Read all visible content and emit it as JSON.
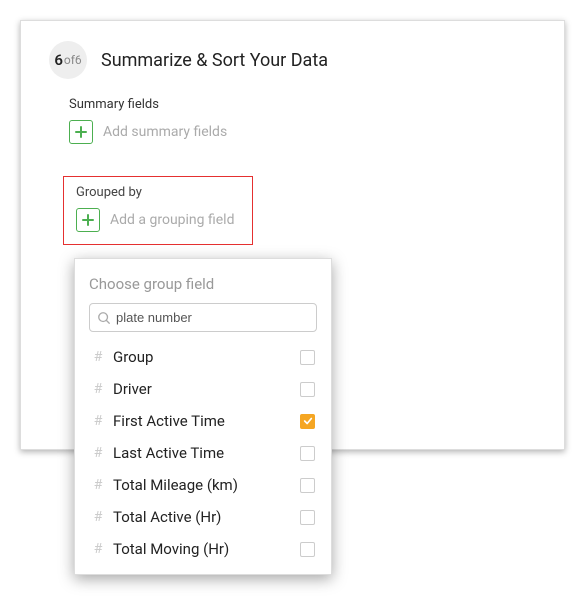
{
  "step": {
    "current": "6",
    "sep": " of ",
    "total": "6",
    "title": "Summarize & Sort Your Data"
  },
  "summary": {
    "label": "Summary fields",
    "placeholder": "Add summary fields"
  },
  "grouped": {
    "label": "Grouped by",
    "placeholder": "Add a grouping field"
  },
  "popover": {
    "title": "Choose group field",
    "search": {
      "value": "plate number"
    },
    "fields": [
      {
        "label": "Group",
        "checked": false
      },
      {
        "label": "Driver",
        "checked": false
      },
      {
        "label": "First Active Time",
        "checked": true
      },
      {
        "label": "Last Active Time",
        "checked": false
      },
      {
        "label": "Total Mileage (km)",
        "checked": false
      },
      {
        "label": "Total Active (Hr)",
        "checked": false
      },
      {
        "label": "Total Moving (Hr)",
        "checked": false
      }
    ]
  }
}
